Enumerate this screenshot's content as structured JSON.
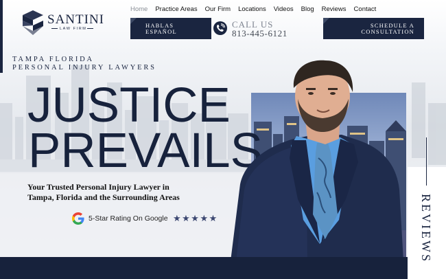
{
  "logo": {
    "name": "SANTINI",
    "sub": "LAW FIRM"
  },
  "nav": {
    "items": [
      {
        "label": "Home"
      },
      {
        "label": "Practice Areas"
      },
      {
        "label": "Our Firm"
      },
      {
        "label": "Locations"
      },
      {
        "label": "Videos"
      },
      {
        "label": "Blog"
      },
      {
        "label": "Reviews"
      },
      {
        "label": "Contact"
      }
    ]
  },
  "header": {
    "hablas_line1": "HABLAS",
    "hablas_line2": "ESPAÑOL",
    "call_label": "CALL US",
    "call_number": "813-445-6121",
    "schedule_line1": "SCHEDULE A",
    "schedule_line2": "CONSULTATION"
  },
  "hero": {
    "kicker_line1": "TAMPA FLORIDA",
    "kicker_line2": "PERSONAL INJURY LAWYERS",
    "headline_line1": "JUSTICE",
    "headline_line2": "PREVAILS",
    "subheading_line1": "Your Trusted Personal Injury Lawyer in",
    "subheading_line2": "Tampa, Florida and the Surrounding Areas",
    "rating_text": "5-Star Rating On Google",
    "stars": "★★★★★",
    "star_count": 5
  },
  "reviews_tab": {
    "label": "REVIEWS"
  },
  "colors": {
    "navy": "#1a2540",
    "deep_navy": "#17223c",
    "star": "#3b4670",
    "shirt": "#5a9ee0"
  },
  "icons": {
    "logo": "logo-mark-icon",
    "phone": "phone-icon",
    "google": "google-g-icon",
    "star": "star-icon"
  }
}
